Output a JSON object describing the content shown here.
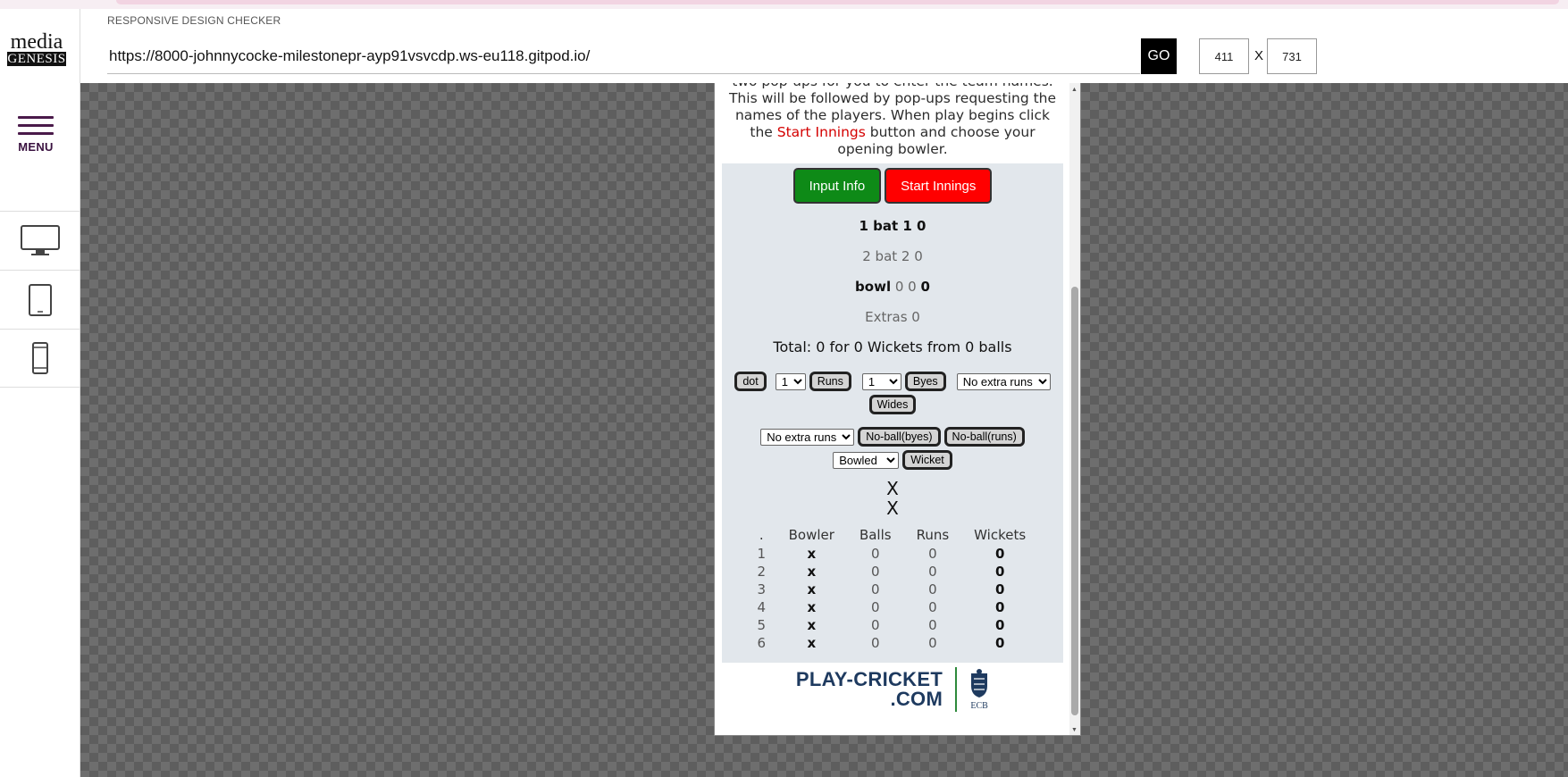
{
  "app": {
    "title": "RESPONSIVE DESIGN CHECKER",
    "logo_line1": "media",
    "logo_line2": "GENESIS",
    "menu_label": "MENU"
  },
  "toolbar": {
    "url": "https://8000-johnnycocke-milestonepr-ayp91vsvcdp.ws-eu118.gitpod.io/",
    "go_label": "GO",
    "width": "411",
    "height": "731",
    "times": "X"
  },
  "devices": [
    "desktop-icon",
    "tablet-icon",
    "phone-icon"
  ],
  "site": {
    "intro_1": "two pop-ups for you to enter the team names. This will be followed by pop-ups requesting the names of the players. When play begins click the ",
    "intro_red": "Start Innings",
    "intro_2": " button and choose your opening bowler.",
    "btn_input": "Input Info",
    "btn_start": "Start Innings",
    "bat1": "1 bat 1 0",
    "bat2": "2 bat 2 0",
    "bowl_label": "bowl",
    "bowl_vals": "0 0",
    "bowl_last": "0",
    "extras": "Extras 0",
    "total": "Total: 0 for 0 Wickets from 0 balls",
    "dot": "dot",
    "runs_sel": "1",
    "runs": "Runs",
    "byes_sel": "1",
    "byes": "Byes",
    "extra_sel1": "No extra runs",
    "wides": "Wides",
    "extra_sel2": "No extra runs",
    "noball_byes": "No-ball(byes)",
    "noball_runs": "No-ball(runs)",
    "wicket_sel": "Bowled",
    "wicket": "Wicket",
    "x1": "X",
    "x2": "X",
    "table_headers": [
      ".",
      "Bowler",
      "Balls",
      "Runs",
      "Wickets"
    ],
    "table_rows": [
      [
        "1",
        "x",
        "0",
        "0",
        "0"
      ],
      [
        "2",
        "x",
        "0",
        "0",
        "0"
      ],
      [
        "3",
        "x",
        "0",
        "0",
        "0"
      ],
      [
        "4",
        "x",
        "0",
        "0",
        "0"
      ],
      [
        "5",
        "x",
        "0",
        "0",
        "0"
      ],
      [
        "6",
        "x",
        "0",
        "0",
        "0"
      ]
    ],
    "footer_line1": "PLAY-CRICKET",
    "footer_line2": ".COM",
    "ecb": "ECB"
  }
}
